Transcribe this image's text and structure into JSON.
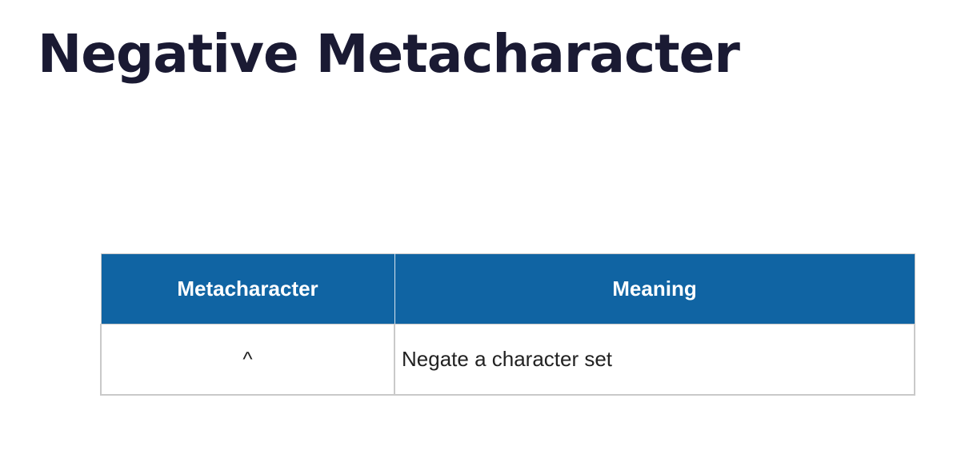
{
  "slide": {
    "title": "Negative Metacharacter"
  },
  "table": {
    "headers": [
      "Metacharacter",
      "Meaning"
    ],
    "rows": [
      {
        "metacharacter": "^",
        "meaning": "Negate a character set"
      }
    ]
  },
  "colors": {
    "header_background": "#1064a3",
    "title_text": "#1a1a33"
  }
}
